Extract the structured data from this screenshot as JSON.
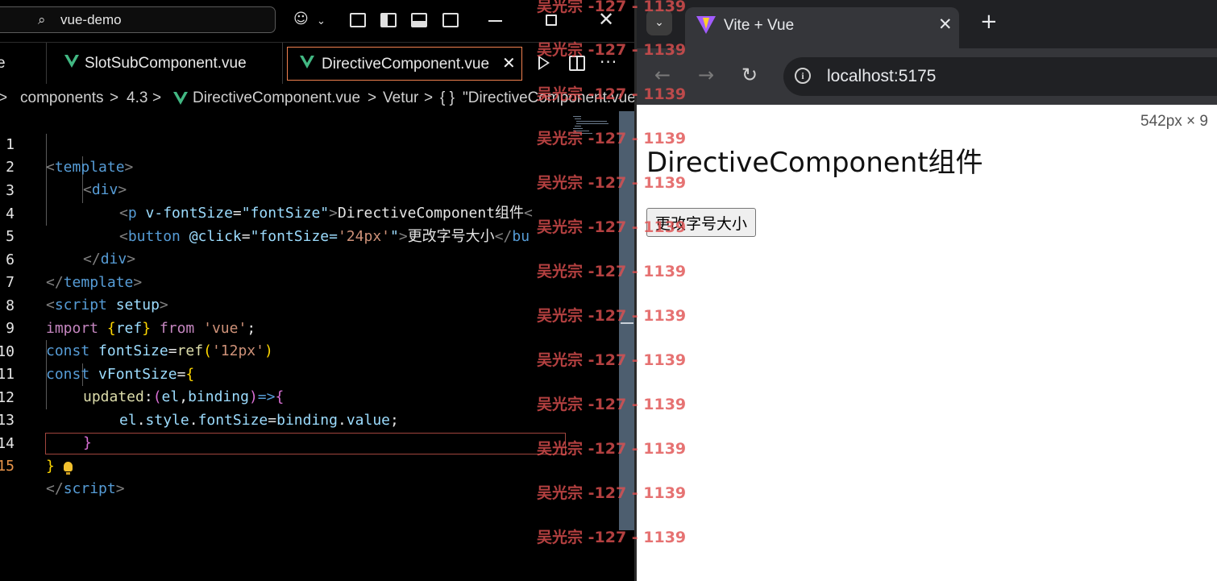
{
  "vscode": {
    "search_label": "vue-demo",
    "tabs": [
      {
        "label": "e"
      },
      {
        "label": "SlotSubComponent.vue"
      },
      {
        "label": "DirectiveComponent.vue",
        "active": true
      }
    ],
    "close_glyph": "✕",
    "breadcrumb": [
      ">",
      "components",
      ">",
      "4.3",
      ">",
      "DirectiveComponent.vue",
      ">",
      "Vetur",
      ">",
      "{ }",
      "\"DirectiveComponent.vue\""
    ],
    "line_numbers": [
      "1",
      "2",
      "3",
      "4",
      "5",
      "6",
      "7",
      "8",
      "9",
      "10",
      "11",
      "12",
      "13",
      "14",
      "15"
    ],
    "code": {
      "l1": [
        "<",
        "template",
        ">"
      ],
      "l2": [
        "<",
        "div",
        ">"
      ],
      "l3": [
        "<",
        "p",
        " ",
        "v-fontSize",
        "=",
        "\"fontSize\"",
        ">",
        "DirectiveComponent组件",
        "<"
      ],
      "l4": [
        "<",
        "button",
        " ",
        "@click",
        "=",
        "\"fontSize=",
        "'24px'",
        "\"",
        ">",
        "更改字号大小",
        "</",
        "bu"
      ],
      "l5": [
        "</",
        "div",
        ">"
      ],
      "l6": [
        "</",
        "template",
        ">"
      ],
      "l7": [
        "<",
        "script",
        " ",
        "setup",
        ">"
      ],
      "l8": [
        "import",
        " ",
        "{",
        "ref",
        "}",
        " ",
        "from",
        " ",
        "'vue'",
        ";"
      ],
      "l9": [
        "const",
        " ",
        "fontSize",
        "=",
        "ref",
        "(",
        "'12px'",
        ")"
      ],
      "l10": [
        "const",
        " ",
        "vFontSize",
        "=",
        "{"
      ],
      "l11": [
        "updated",
        ":",
        "(",
        "el",
        ",",
        "binding",
        ")",
        "=>",
        "{"
      ],
      "l12": [
        "el",
        ".",
        "style",
        ".",
        "fontSize",
        "=",
        "binding",
        ".",
        "value",
        ";"
      ],
      "l13": [
        "}"
      ],
      "l14": [
        "}"
      ],
      "l15": [
        "</",
        "script",
        ">"
      ]
    },
    "icons": {
      "search": "search-icon",
      "copilot": "copilot-icon",
      "layout": "layout-icons",
      "run": "run-icon",
      "split": "split-editor-icon",
      "more": "more-actions-icon",
      "bulb": "lightbulb-icon"
    }
  },
  "browser": {
    "tab_title": "Vite + Vue",
    "url": "localhost:5175",
    "viewport_size": "542px × 9",
    "page": {
      "heading": "DirectiveComponent组件",
      "button_label": "更改字号大小"
    },
    "colors": {
      "vite_purple": "#a25cff",
      "vite_yellow": "#ffd028"
    }
  },
  "watermark": [
    "吴光宗 -127 - 1139",
    "吴光宗 -127 - 1139",
    "吴光宗 -127 - 1139",
    "吴光宗 -127 - 1139",
    "吴光宗 -127 - 1139",
    "吴光宗 -127 - 1139",
    "吴光宗 -127 - 1139",
    "吴光宗 -127 - 1139",
    "吴光宗 -127 - 1139",
    "吴光宗 -127 - 1139",
    "吴光宗 -127 - 1139",
    "吴光宗 -127 - 1139",
    "吴光宗 -127 - 1139"
  ],
  "colors": {
    "accent_tab_border": "#f1814f",
    "vue_green": "#42b883",
    "watermark": "#e05050"
  }
}
